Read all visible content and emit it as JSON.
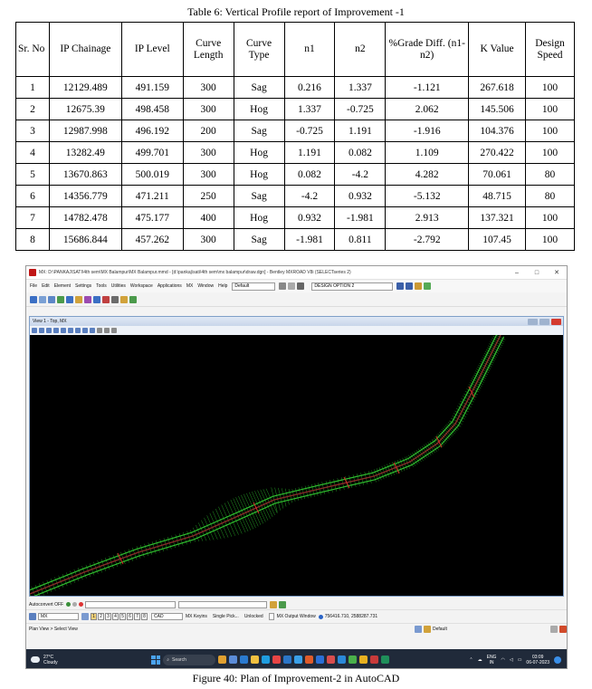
{
  "table": {
    "caption": "Table 6: Vertical Profile report of Improvement -1",
    "headers": {
      "sr": "Sr. No",
      "ip_chainage": "IP Chainage",
      "ip_level": "IP Level",
      "curve_length": "Curve Length",
      "curve_type": "Curve Type",
      "n1": "n1",
      "n2": "n2",
      "grade_diff": "%Grade Diff. (n1-n2)",
      "k_value": "K Value",
      "design_speed": "Design Speed"
    },
    "rows": [
      [
        "1",
        "12129.489",
        "491.159",
        "300",
        "Sag",
        "0.216",
        "1.337",
        "-1.121",
        "267.618",
        "100"
      ],
      [
        "2",
        "12675.39",
        "498.458",
        "300",
        "Hog",
        "1.337",
        "-0.725",
        "2.062",
        "145.506",
        "100"
      ],
      [
        "3",
        "12987.998",
        "496.192",
        "200",
        "Sag",
        "-0.725",
        "1.191",
        "-1.916",
        "104.376",
        "100"
      ],
      [
        "4",
        "13282.49",
        "499.701",
        "300",
        "Hog",
        "1.191",
        "0.082",
        "1.109",
        "270.422",
        "100"
      ],
      [
        "5",
        "13670.863",
        "500.019",
        "300",
        "Hog",
        "0.082",
        "-4.2",
        "4.282",
        "70.061",
        "80"
      ],
      [
        "6",
        "14356.779",
        "471.211",
        "250",
        "Sag",
        "-4.2",
        "0.932",
        "-5.132",
        "48.715",
        "80"
      ],
      [
        "7",
        "14782.478",
        "475.177",
        "400",
        "Hog",
        "0.932",
        "-1.981",
        "2.913",
        "137.321",
        "100"
      ],
      [
        "8",
        "15686.844",
        "457.262",
        "300",
        "Sag",
        "-1.981",
        "0.811",
        "-2.792",
        "107.45",
        "100"
      ]
    ]
  },
  "app": {
    "window_title": "MX: D:\\PANKAJ\\SATI\\4th sem\\MX Balampur\\MX Balampur.mmd - [d:\\pankaj\\sati\\4th sem\\mx balampur\\draw.dgn] - Bentley MXROAD V8i (SELECTseries 2)",
    "menu": [
      "File",
      "Edit",
      "Element",
      "Settings",
      "Tools",
      "Utilities",
      "Workspace",
      "Applications",
      "MX",
      "Window",
      "Help"
    ],
    "level_select": "Default",
    "design_option": "DESIGN OPTION 2",
    "view_title": "View 1 - Top, MX",
    "autoconvert": "Autoconvert OFF",
    "mx_label": "MX",
    "cad_select": "CAD",
    "mx_keyins": "MX Keyins",
    "single_pick": "Single Pick...",
    "unlocked": "Unlocked",
    "mx_output": "MX Output Window",
    "coords": "756416.710, 2588287.731",
    "status_left": "Plan View > Select View",
    "status_default": "Default",
    "view_numbers": [
      "1",
      "2",
      "3",
      "4",
      "5",
      "6",
      "7",
      "8"
    ],
    "colors": {
      "alignment_green": "#2fbf2f",
      "alignment_red": "#d42a2a",
      "canvas_bg": "#000000",
      "taskbar_bg": "#202a3a"
    }
  },
  "taskbar": {
    "weather_temp": "27°C",
    "weather_desc": "Cloudy",
    "search": "Search",
    "lang": "ENG",
    "region": "IN",
    "time": "03:09",
    "date": "06-07-2023"
  },
  "figure_caption": "Figure 40: Plan of Improvement-2 in AutoCAD"
}
